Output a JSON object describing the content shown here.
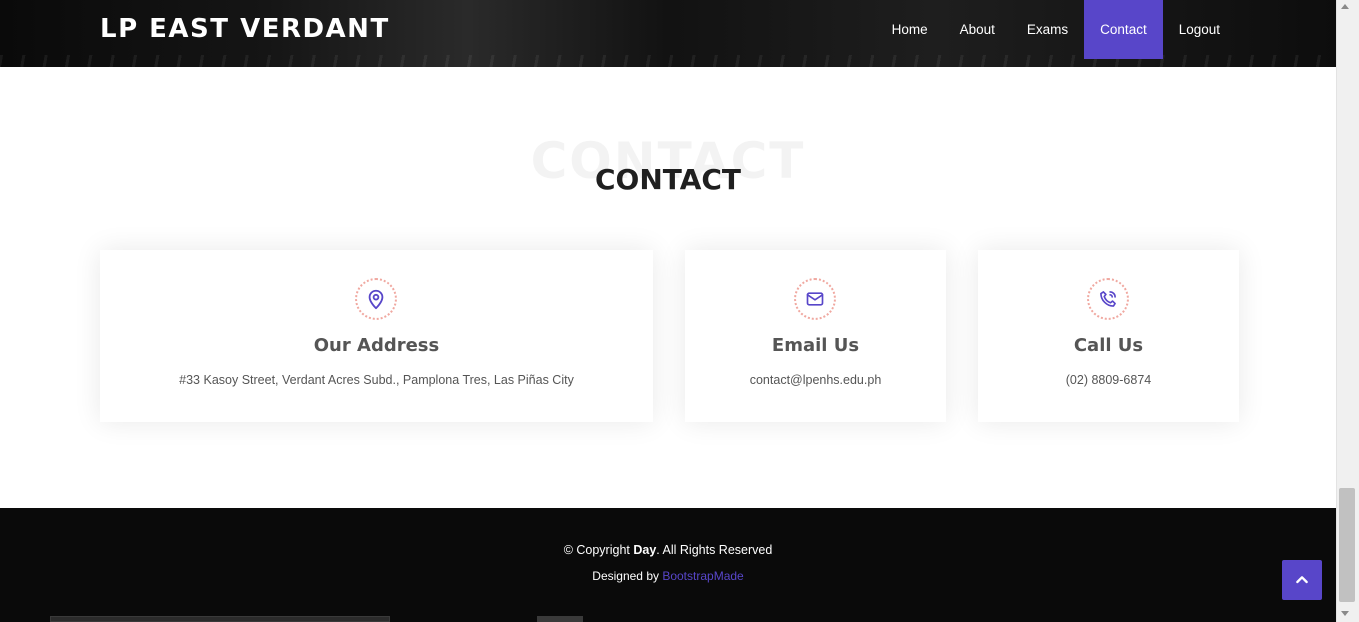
{
  "header": {
    "logo": "LP EAST VERDANT",
    "nav": [
      {
        "label": "Home"
      },
      {
        "label": "About"
      },
      {
        "label": "Exams"
      },
      {
        "label": "Contact",
        "active": true
      },
      {
        "label": "Logout"
      }
    ]
  },
  "section": {
    "watermark": "CONTACT",
    "title": "CONTACT"
  },
  "cards": {
    "address": {
      "icon": "map-pin-icon",
      "title": "Our Address",
      "text": "#33 Kasoy Street, Verdant Acres Subd., Pamplona Tres, Las Piñas City"
    },
    "email": {
      "icon": "envelope-icon",
      "title": "Email Us",
      "text": "contact@lpenhs.edu.ph"
    },
    "phone": {
      "icon": "phone-icon",
      "title": "Call Us",
      "text": "(02) 8809-6874"
    }
  },
  "footer": {
    "copyright_prefix": "© Copyright ",
    "copyright_name": "Day",
    "copyright_suffix": ". All Rights Reserved",
    "designed_by": "Designed by ",
    "designer": "BootstrapMade"
  },
  "colors": {
    "accent": "#5846c9",
    "icon_ring": "#f0a8a0",
    "footer_bg": "#0a0a0a"
  }
}
